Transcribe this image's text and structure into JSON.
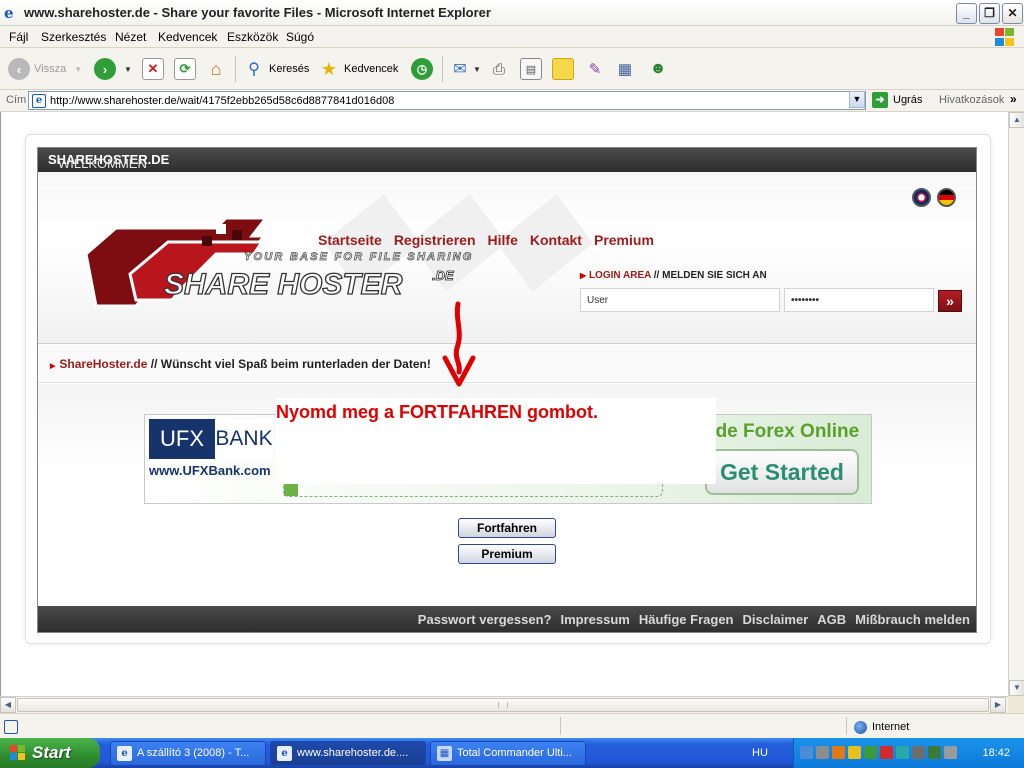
{
  "window": {
    "title": "www.sharehoster.de - Share your favorite Files - Microsoft Internet Explorer",
    "minimize_glyph": "_",
    "maximize_glyph": "❐",
    "close_glyph": "✕"
  },
  "menu": {
    "items": [
      "Fájl",
      "Szerkesztés",
      "Nézet",
      "Kedvencek",
      "Eszközök",
      "Súgó"
    ]
  },
  "toolbar": {
    "back_label": "Vissza",
    "search_label": "Keresés",
    "favorites_label": "Kedvencek"
  },
  "address": {
    "label": "Cím",
    "url": "http://www.sharehoster.de/wait/4175f2ebb265d58c6d8877841d016d08",
    "go_label": "Ugrás",
    "links_label": "Hivatkozások",
    "links_more": "»"
  },
  "site": {
    "welcome_prefix": "WILLKOMMEN BEI",
    "welcome_brand": "SHAREHOSTER.DE",
    "nav": [
      "Startseite",
      "Registrieren",
      "Hilfe",
      "Kontakt",
      "Premium"
    ],
    "logo_tagline": "YOUR BASE FOR FILE SHARING",
    "logo_text": "SHARE HOSTER",
    "logo_suffix": ".DE",
    "login_area_label": "LOGIN AREA",
    "login_area_sep": " // ",
    "login_area_hint": "MELDEN SIE SICH AN",
    "login_user_value": "User",
    "login_password_value": "••••••••",
    "login_submit": "»",
    "crumb_brand": "ShareHoster.de",
    "crumb_sep": " // ",
    "crumb_text": "Wünscht viel Spaß beim runterladen der Daten!",
    "overlay_message": "Nyomd meg a FORTFAHREN gombot.",
    "button_continue": "Fortfahren",
    "button_premium": "Premium",
    "footer_links": [
      "Passwort vergessen?",
      "Impressum",
      "Häufige Fragen",
      "Disclaimer",
      "AGB",
      "Mißbrauch melden"
    ]
  },
  "ad": {
    "ufx": "UFX",
    "bank": "BANK",
    "url": "www.UFXBank.com",
    "trade": "ade Forex Online",
    "cta": "Get Started"
  },
  "status": {
    "zone": "Internet"
  },
  "taskbar": {
    "start_label": "Start",
    "tasks": [
      "A szállító 3 (2008) - T...",
      "www.sharehoster.de....",
      "Total Commander Ulti..."
    ],
    "language": "HU",
    "clock": "18:42"
  },
  "colors": {
    "brand_red": "#9c1c1c",
    "overlay_red": "#e00000",
    "xp_blue": "#245edb",
    "start_green": "#2f8d2f"
  }
}
